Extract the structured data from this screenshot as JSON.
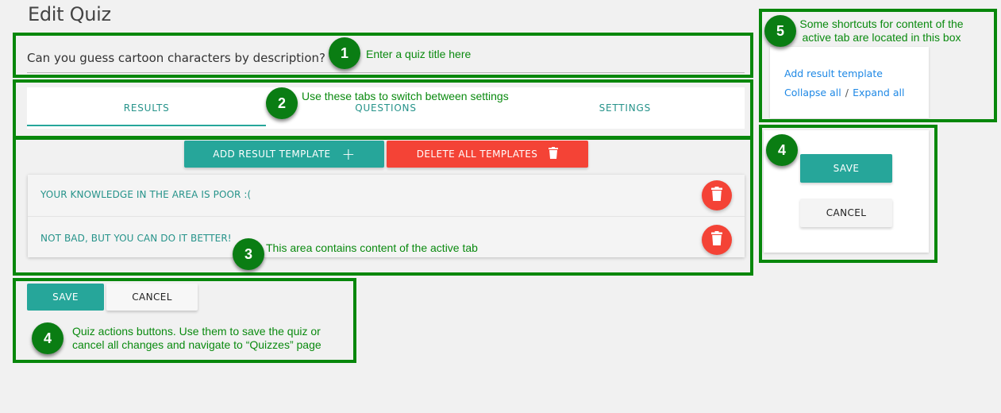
{
  "page": {
    "title": "Edit Quiz"
  },
  "quiz_title": {
    "value": "Can you guess cartoon characters by description?"
  },
  "tabs": [
    {
      "label": "RESULTS",
      "active": true
    },
    {
      "label": "QUESTIONS",
      "active": false
    },
    {
      "label": "SETTINGS",
      "active": false
    }
  ],
  "toolbar": {
    "add_label": "ADD RESULT TEMPLATE",
    "add_icon": "+",
    "delete_all_label": "DELETE ALL TEMPLATES"
  },
  "results": [
    {
      "label": "YOUR KNOWLEDGE IN THE AREA IS POOR :("
    },
    {
      "label": "NOT BAD, BUT YOU CAN DO IT BETTER!"
    }
  ],
  "actions": {
    "save_label": "SAVE",
    "cancel_label": "CANCEL"
  },
  "shortcuts": {
    "add_result_template": "Add result template",
    "collapse_all": "Collapse all",
    "separator": "/",
    "expand_all": "Expand all"
  },
  "side_actions": {
    "save_label": "SAVE",
    "cancel_label": "CANCEL"
  },
  "annotations": [
    {
      "number": "1",
      "text": "Enter a quiz title here"
    },
    {
      "number": "2",
      "text": "Use these tabs to switch between settings"
    },
    {
      "number": "3",
      "text": "This area contains content of the active tab"
    },
    {
      "number": "4",
      "text_line1": "Quiz actions buttons. Use them to save the quiz or",
      "text_line2": "cancel all changes and navigate to “Quizzes” page"
    },
    {
      "number": "5",
      "text_line1": "Some shortcuts for content of the",
      "text_line2": "active tab are located in this box"
    },
    {
      "number": "4"
    }
  ],
  "colors": {
    "accent_teal": "#26a69a",
    "danger_red": "#f44336",
    "annotation_green": "#07870b",
    "link_blue": "#1e88e5"
  }
}
